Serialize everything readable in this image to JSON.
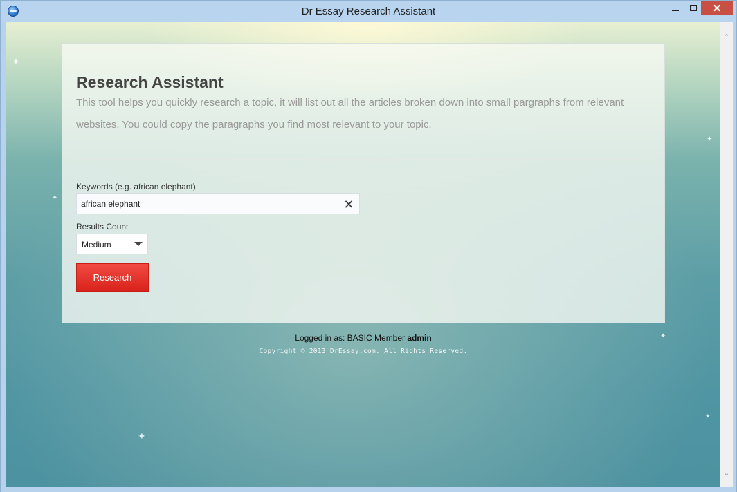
{
  "window": {
    "title": "Dr Essay Research Assistant",
    "close_glyph": "✕",
    "icon": "app-globe-icon"
  },
  "scrollbar": {
    "up_glyph": "⌃",
    "down_glyph": "⌄"
  },
  "panel": {
    "title": "Research Assistant",
    "description": "This tool helps you quickly research a topic, it will list out all the articles broken down into small pargraphs from relevant websites. You could copy the paragraphs you find most relevant to your topic.",
    "keywords_label": "Keywords (e.g. african elephant)",
    "keywords_value": "african elephant",
    "clear_glyph": "✕",
    "results_count_label": "Results Count",
    "results_count_value": "Medium",
    "research_button": "Research"
  },
  "footer": {
    "logged_in_prefix": "Logged in as: BASIC Member",
    "username": "admin",
    "copyright": "Copyright © 2013 DrEssay.com. All Rights Reserved."
  },
  "colors": {
    "accent_button": "#e0332b",
    "close_button": "#c74f43",
    "title_text": "#444444",
    "description_text": "#9a9a9a"
  }
}
